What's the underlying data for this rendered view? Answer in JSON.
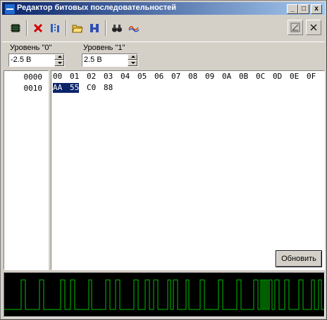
{
  "window": {
    "title": "Редактор битовых последовательностей",
    "buttons": {
      "minimize": "_",
      "maximize": "□",
      "close": "x"
    }
  },
  "levels": {
    "zero_label": "Уровень \"0\"",
    "zero_value": "-2.5 В",
    "one_label": "Уровень \"1\"",
    "one_value": "2.5 В"
  },
  "addresses": [
    "0000",
    "0010"
  ],
  "header": [
    "00",
    "01",
    "02",
    "03",
    "04",
    "05",
    "06",
    "07",
    "08",
    "09",
    "0A",
    "0B",
    "0C",
    "0D",
    "0E",
    "0F"
  ],
  "bytes": [
    "AA",
    "55",
    "C0",
    "88"
  ],
  "selected_bytes": 2,
  "refresh_label": "Обновить",
  "colors": {
    "titlebar_start": "#0a246a",
    "titlebar_end": "#a6caf0",
    "selection": "#0a246a",
    "trace": "#00c000",
    "scope_bg": "#000000"
  },
  "icons": {
    "toolbar": [
      "chip-icon",
      "delete-icon",
      "bits-icon",
      "open-folder-icon",
      "h-icon",
      "binoculars-icon",
      "waveform-icon"
    ],
    "right": [
      "edit-icon",
      "close-panel-icon"
    ]
  }
}
